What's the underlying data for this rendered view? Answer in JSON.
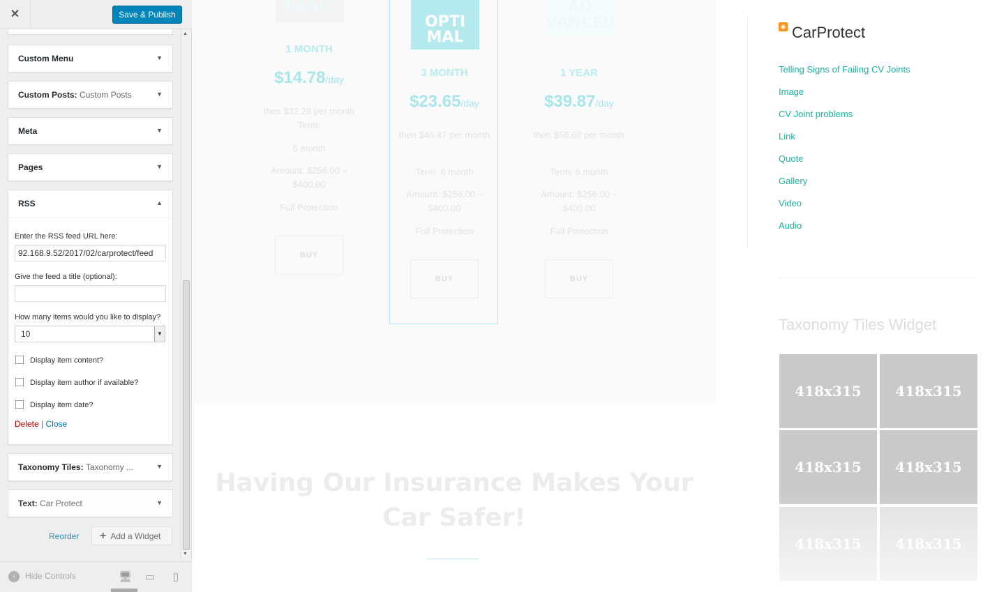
{
  "header": {
    "close_icon": "close-icon",
    "publish_label": "Save & Publish"
  },
  "widgets": [
    {
      "title": "Custom Menu",
      "sub": ""
    },
    {
      "title": "Custom Posts:",
      "sub": "Custom Posts"
    },
    {
      "title": "Meta",
      "sub": ""
    },
    {
      "title": "Pages",
      "sub": ""
    }
  ],
  "rss_widget": {
    "title": "RSS",
    "url_label": "Enter the RSS feed URL here:",
    "url_value": "92.168.9.52/2017/02/carprotect/feed",
    "feed_title_label": "Give the feed a title (optional):",
    "feed_title_value": "",
    "items_label": "How many items would you like to display?",
    "items_value": "10",
    "checkboxes": [
      {
        "label": "Display item content?",
        "checked": false
      },
      {
        "label": "Display item author if available?",
        "checked": false
      },
      {
        "label": "Display item date?",
        "checked": false
      }
    ],
    "delete_label": "Delete",
    "separator": "|",
    "close_label": "Close"
  },
  "widgets_after": [
    {
      "title": "Taxonomy Tiles:",
      "sub": "Taxonomy ..."
    },
    {
      "title": "Text:",
      "sub": "Car Protect"
    }
  ],
  "footer_actions": {
    "reorder_label": "Reorder",
    "add_widget_label": "Add a Widget"
  },
  "panel_footer": {
    "hide_controls_label": "Hide Controls"
  },
  "preview": {
    "plans": [
      {
        "badge": "BASIC",
        "term": "1 MONTH",
        "price": "$14.78",
        "per": "/day",
        "lines": [
          "then $32.28 per month Term:",
          "6 month",
          "Amount: $256.00 – $400.00",
          "Full Protection"
        ],
        "buy": "BUY"
      },
      {
        "badge": "OPTI MAL",
        "term": "3 MONTH",
        "price": "$23.65",
        "per": "/day",
        "lines": [
          "then $46.47 per month",
          "Term: 6 month",
          "Amount: $256.00 – $400.00",
          "Full Protection"
        ],
        "buy": "BUY"
      },
      {
        "badge": "AD VANCED",
        "term": "1 YEAR",
        "price": "$39.87",
        "per": "/day",
        "lines": [
          "then $58.68 per month",
          "Term: 6 month",
          "Amount: $256.00 – $400.00",
          "Full Protection"
        ],
        "buy": "BUY"
      }
    ],
    "headline": "Having Our Insurance Makes Your Car Safer!",
    "sidebar": {
      "rss_title": "CarProtect",
      "rss_items": [
        "Telling Signs of Failing CV Joints",
        "Image",
        "CV Joint problems",
        "Link",
        "Quote",
        "Gallery",
        "Video",
        "Audio"
      ],
      "taxonomy_title": "Taxonomy Tiles Widget",
      "tile_label": "418x315"
    }
  },
  "colors": {
    "publish": "#0085ba",
    "link": "#0073aa",
    "delete": "#a00000",
    "accent": "#1cb3a0"
  }
}
